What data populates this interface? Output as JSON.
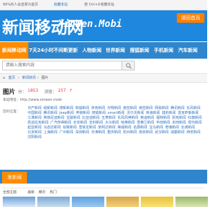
{
  "topbar": {
    "left_text": "99%的人会选择为首页",
    "favorite": "收藏本站",
    "hint": "按 Ctrl+D收藏本站"
  },
  "logo": {
    "cn": "新闻移动网",
    "en": "XinWen.Mobi"
  },
  "header_button": "请回首页",
  "nav": [
    "新闻移动网",
    "7天24小时不间断更新",
    "人物新闻",
    "世界新闻",
    "搜狐新闻",
    "手机新闻",
    "汽车新闻"
  ],
  "search": {
    "placeholder": "请输入搜索内容"
  },
  "breadcrumb": {
    "home": "首页",
    "section": "新闻快讯",
    "current": "图片"
  },
  "article": {
    "title": "图片",
    "author_label": "分：",
    "author_value": "1853",
    "views_label": "浏览：",
    "views_value": "257",
    "url": "本站地址：http://www.xinwen.mobi"
  },
  "tags_label": "您的位置：",
  "tags": [
    "日产新闻",
    "组新新闻",
    "搜新新闻",
    "权威新闻",
    "林肯新闻",
    "光明新闻",
    "疾控新闻",
    "疾控新闻",
    "网易新闻",
    "腾讯新闻",
    "东风新闻",
    "中国新闻",
    "腾讯新闻",
    "Jeep新闻",
    "奔驰新闻",
    "搜狐新闻",
    "smart新闻",
    "沃尔沃新闻",
    "新浪新闻",
    "猎豹新闻",
    "雷克萨斯新闻",
    "江淮新闻",
    "英菲尼迪新闻",
    "宝骏新闻",
    "比亚迪新闻",
    "五菱新闻",
    "东风风神新闻",
    "奥迪新闻",
    "福特新闻",
    "别克新闻",
    "红旗新闻",
    "凯迪拉克新闻",
    "广汽传祺新闻",
    "长安新闻",
    "吉利新闻",
    "大众新闻",
    "哈弗新闻",
    "雪佛兰新闻",
    "丰田新闻",
    "本田新闻",
    "现代新闻",
    "起亚新闻",
    "马自达新闻",
    "标致新闻",
    "雪铁龙新闻",
    "斯柯达新闻",
    "荣威新闻",
    "名爵新闻",
    "宝马新闻",
    "奇瑞新闻",
    "长城新闻",
    "北京新闻",
    "上海新闻",
    "广州新闻",
    "深圳新闻",
    "天津新闻",
    "重庆新闻",
    "杭州新闻",
    "南京新闻",
    "武汉新闻",
    "成都新闻",
    "西安新闻",
    "沈阳新闻"
  ],
  "section": {
    "tab": "发新闻"
  },
  "sort": {
    "label": "全部主题",
    "options": [
      "最新",
      "精华",
      "热门"
    ]
  },
  "colors": {
    "brand_blue": "#1f87dd",
    "nav_blue": "#2f86cc",
    "accent_orange": "#ff8b00",
    "link_blue": "#2f6fbf"
  }
}
